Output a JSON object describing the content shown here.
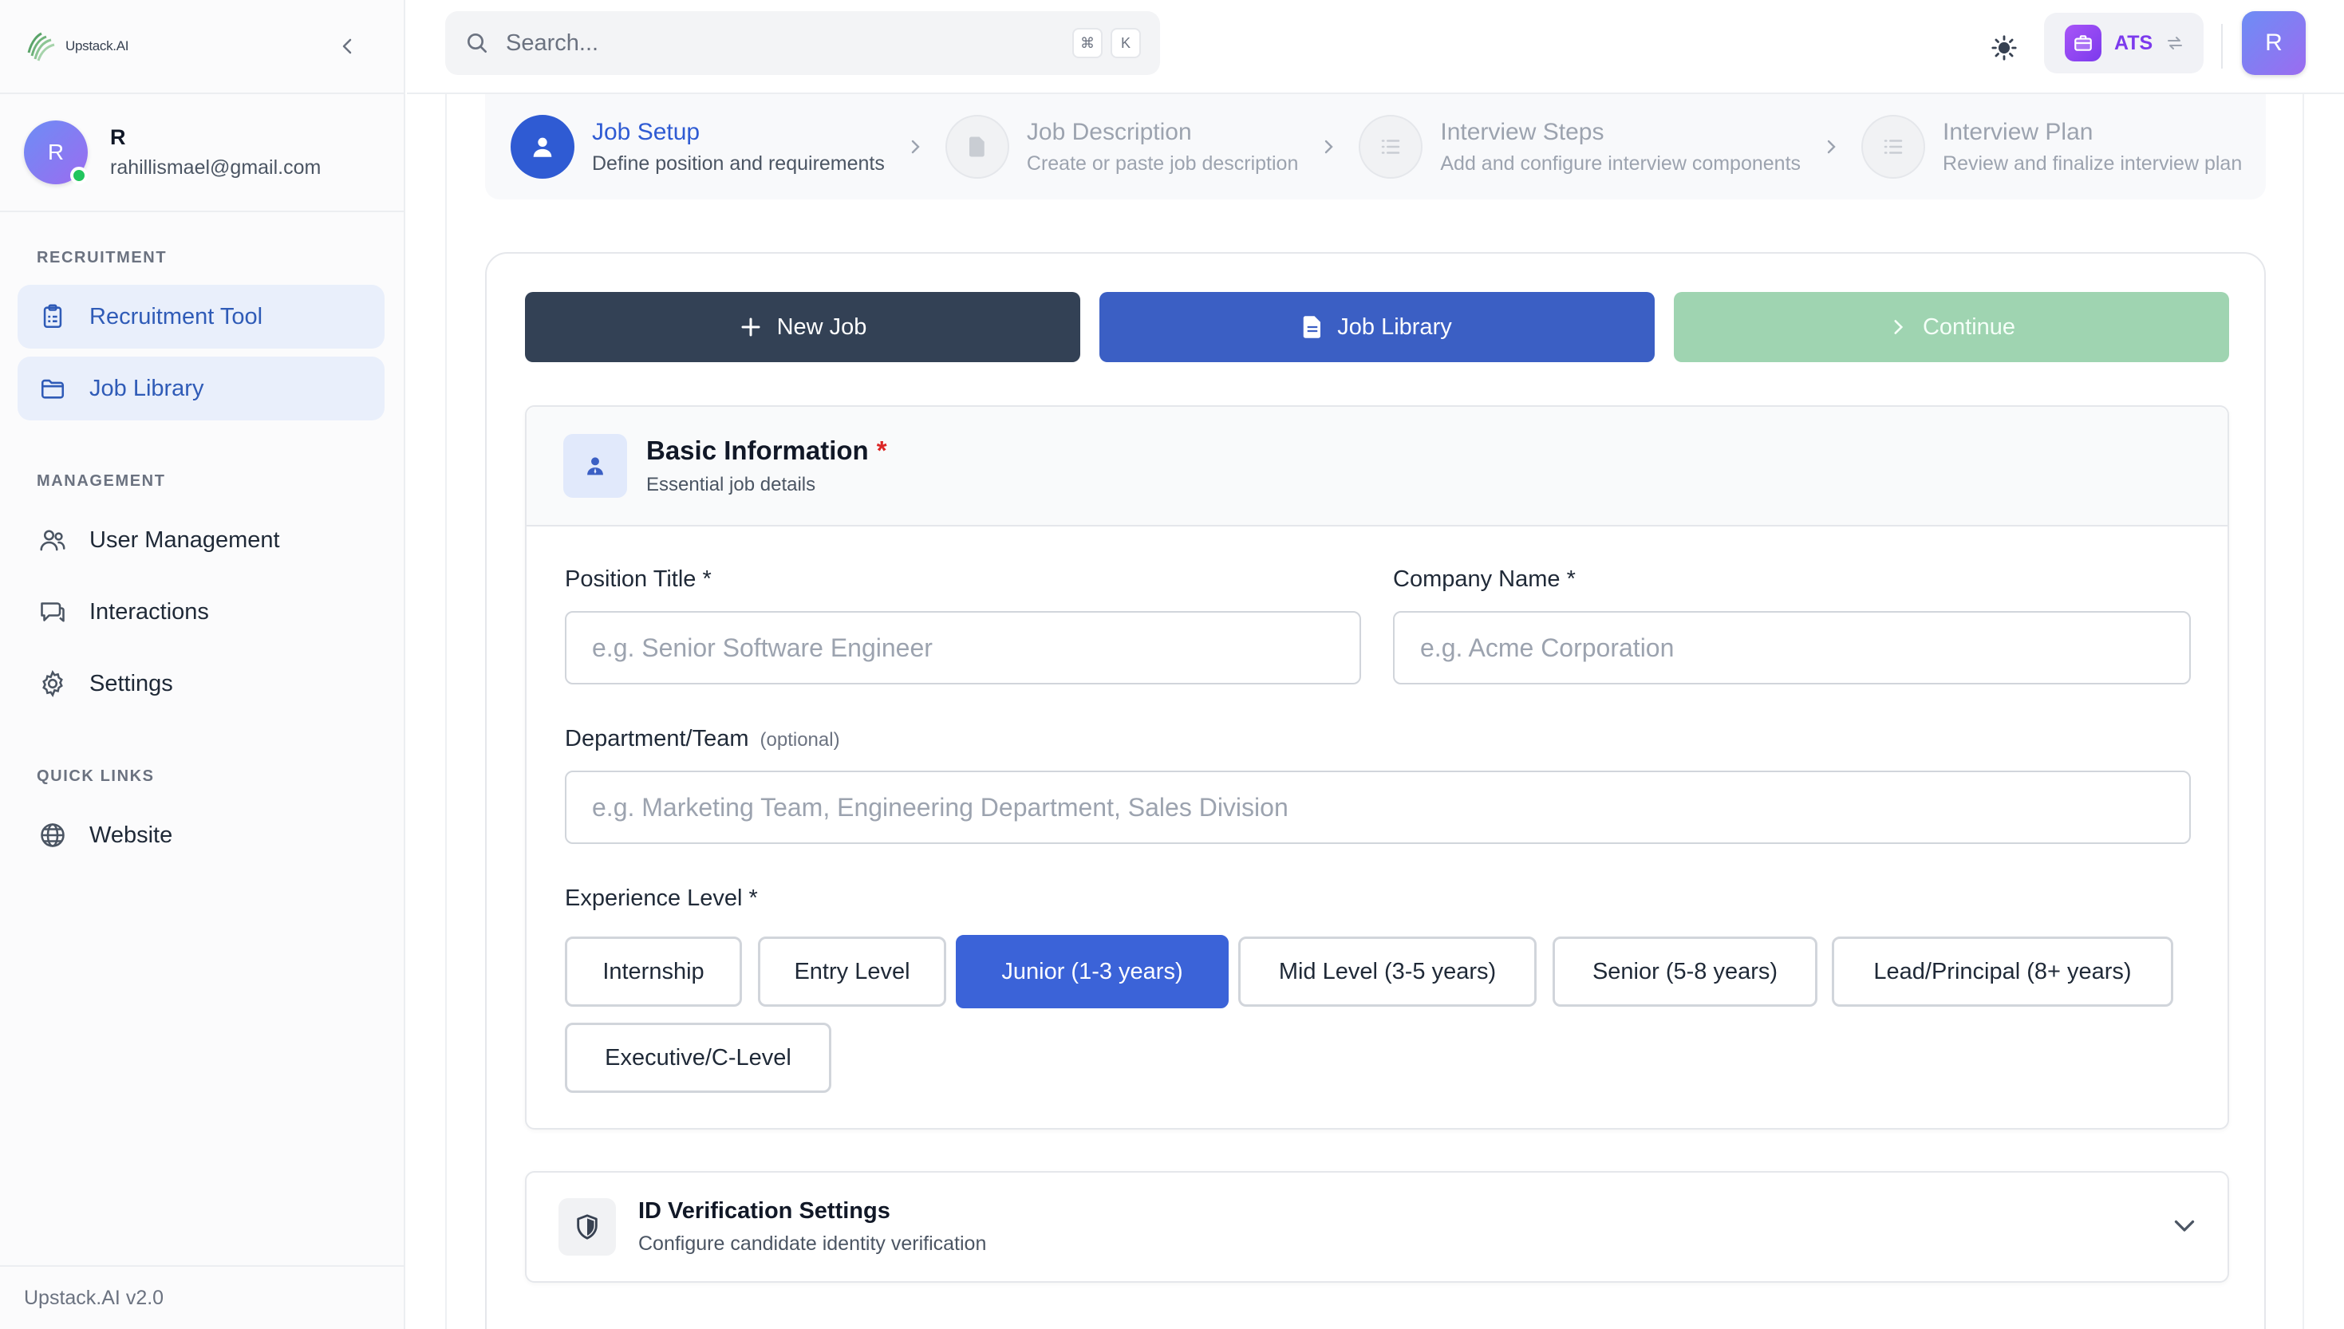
{
  "app": {
    "logo_text": "Upstack.AI",
    "version": "Upstack.AI v2.0"
  },
  "user": {
    "initial": "R",
    "name": "R",
    "email": "rahillismael@gmail.com"
  },
  "sidebar": {
    "sections": [
      {
        "label": "RECRUITMENT",
        "items": [
          {
            "label": "Recruitment Tool",
            "icon": "clipboard-icon",
            "active": true
          },
          {
            "label": "Job Library",
            "icon": "folder-icon",
            "active": true
          }
        ]
      },
      {
        "label": "MANAGEMENT",
        "items": [
          {
            "label": "User Management",
            "icon": "users-icon"
          },
          {
            "label": "Interactions",
            "icon": "chat-icon"
          },
          {
            "label": "Settings",
            "icon": "gear-icon"
          }
        ]
      },
      {
        "label": "QUICK LINKS",
        "items": [
          {
            "label": "Website",
            "icon": "globe-icon"
          }
        ]
      }
    ]
  },
  "topbar": {
    "search_placeholder": "Search...",
    "kbd_1": "⌘",
    "kbd_2": "K",
    "ats_label": "ATS",
    "avatar_initial": "R"
  },
  "stepper": {
    "steps": [
      {
        "title": "Job Setup",
        "subtitle": "Define position and requirements",
        "active": true
      },
      {
        "title": "Job Description",
        "subtitle": "Create or paste job description"
      },
      {
        "title": "Interview Steps",
        "subtitle": "Add and configure interview components"
      },
      {
        "title": "Interview Plan",
        "subtitle": "Review and finalize interview plan"
      }
    ]
  },
  "actions": {
    "new_job": "New Job",
    "job_library": "Job Library",
    "continue": "Continue"
  },
  "basic_info": {
    "title": "Basic Information",
    "required_mark": "*",
    "subtitle": "Essential job details",
    "position_label": "Position Title *",
    "position_placeholder": "e.g. Senior Software Engineer",
    "company_label": "Company Name *",
    "company_placeholder": "e.g. Acme Corporation",
    "department_label": "Department/Team",
    "department_optional": "(optional)",
    "department_placeholder": "e.g. Marketing Team, Engineering Department, Sales Division",
    "experience_label": "Experience Level *",
    "experience_levels": [
      "Internship",
      "Entry Level",
      "Junior (1-3 years)",
      "Mid Level (3-5 years)",
      "Senior (5-8 years)",
      "Lead/Principal (8+ years)",
      "Executive/C-Level"
    ],
    "selected_level": "Junior (1-3 years)"
  },
  "id_verification": {
    "title": "ID Verification Settings",
    "subtitle": "Configure candidate identity verification"
  },
  "colors": {
    "primary": "#2f5bd3",
    "dark_button": "#334155",
    "continue_disabled": "#9fd4b1",
    "active_nav_bg": "#e9effb",
    "ats_purple": "#7c3aed"
  }
}
